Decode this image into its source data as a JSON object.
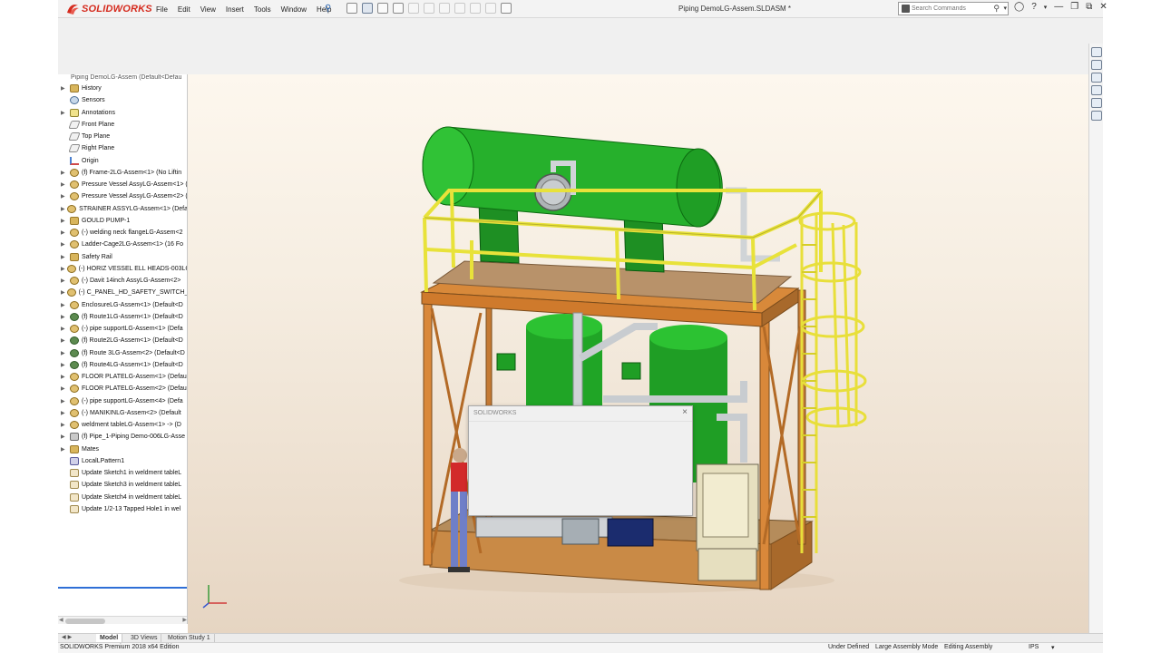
{
  "app": {
    "brand": "SOLIDWORKS",
    "document_title": "Piping DemoLG-Assem.SLDASM *"
  },
  "menu": {
    "items": [
      "File",
      "Edit",
      "View",
      "Insert",
      "Tools",
      "Window",
      "Help"
    ]
  },
  "search": {
    "placeholder": "Search Commands"
  },
  "window_controls": [
    "user-icon",
    "help-icon",
    "minimize-icon",
    "restore-icon",
    "close-icon"
  ],
  "feature_tree": {
    "root": "Piping DemoLG-Assem (Default<Defau",
    "items": [
      {
        "label": "History",
        "icon": "history-folder-icon",
        "expandable": true
      },
      {
        "label": "Sensors",
        "icon": "sensor-icon",
        "expandable": false
      },
      {
        "label": "Annotations",
        "icon": "annotation-icon",
        "expandable": true
      },
      {
        "label": "Front Plane",
        "icon": "plane-icon",
        "expandable": false
      },
      {
        "label": "Top Plane",
        "icon": "plane-icon",
        "expandable": false
      },
      {
        "label": "Right Plane",
        "icon": "plane-icon",
        "expandable": false
      },
      {
        "label": "Origin",
        "icon": "origin-icon",
        "expandable": false
      },
      {
        "label": "(f) Frame-2LG-Assem<1> (No Liftin",
        "icon": "assembly-icon",
        "expandable": true
      },
      {
        "label": "Pressure Vessel AssyLG-Assem<1> (",
        "icon": "assembly-icon",
        "expandable": true
      },
      {
        "label": "Pressure Vessel AssyLG-Assem<2> (",
        "icon": "assembly-icon",
        "expandable": true
      },
      {
        "label": "STRAINER ASSYLG-Assem<1> (Defa",
        "icon": "assembly-icon",
        "expandable": true
      },
      {
        "label": "GOULD PUMP-1",
        "icon": "folder-icon",
        "expandable": true
      },
      {
        "label": "(-) welding neck flangeLG-Assem<2",
        "icon": "assembly-icon",
        "expandable": true
      },
      {
        "label": "Ladder-Cage2LG-Assem<1> (16 Fo",
        "icon": "assembly-icon",
        "expandable": true
      },
      {
        "label": "Safety Rail",
        "icon": "folder-icon",
        "expandable": true
      },
      {
        "label": "(-) HORIZ VESSEL ELL HEADS-003LG",
        "icon": "assembly-icon",
        "expandable": true
      },
      {
        "label": "(-) Davit 14inch AssyLG-Assem<2>",
        "icon": "assembly-icon",
        "expandable": true
      },
      {
        "label": "(-) C_PANEL_HD_SAFETY_SWITCH_",
        "icon": "assembly-icon",
        "expandable": true
      },
      {
        "label": "EnclosureLG-Assem<1> (Default<D",
        "icon": "assembly-icon",
        "expandable": true
      },
      {
        "label": "(f) Route1LG-Assem<1> (Default<D",
        "icon": "route-icon",
        "expandable": true
      },
      {
        "label": "(-) pipe supportLG-Assem<1> (Defa",
        "icon": "assembly-icon",
        "expandable": true
      },
      {
        "label": "(f) Route2LG-Assem<1> (Default<D",
        "icon": "route-icon",
        "expandable": true
      },
      {
        "label": "(f) Route 3LG-Assem<2> (Default<D",
        "icon": "route-icon",
        "expandable": true
      },
      {
        "label": "(f) Route4LG-Assem<1> (Default<D",
        "icon": "route-icon",
        "expandable": true
      },
      {
        "label": "FLOOR PLATELG-Assem<1> (Defau",
        "icon": "assembly-icon",
        "expandable": true
      },
      {
        "label": "FLOOR PLATELG-Assem<2> (Defau",
        "icon": "assembly-icon",
        "expandable": true
      },
      {
        "label": "(-) pipe supportLG-Assem<4> (Defa",
        "icon": "assembly-icon",
        "expandable": true
      },
      {
        "label": "(-) MANIKINLG-Assem<2> (Default",
        "icon": "assembly-icon",
        "expandable": true
      },
      {
        "label": "weldment tableLG-Assem<1> -> (D",
        "icon": "assembly-icon",
        "expandable": true
      },
      {
        "label": "(f) Pipe_1-Piping Demo-006LG-Asse",
        "icon": "part-icon",
        "expandable": true
      },
      {
        "label": "Mates",
        "icon": "mates-folder-icon",
        "expandable": true
      },
      {
        "label": "LocalLPattern1",
        "icon": "pattern-icon",
        "expandable": false
      },
      {
        "label": "Update Sketch1 in weldment tableL",
        "icon": "update-icon",
        "expandable": false
      },
      {
        "label": "Update Sketch3 in weldment tableL",
        "icon": "update-icon",
        "expandable": false
      },
      {
        "label": "Update Sketch4 in weldment tableL",
        "icon": "update-icon",
        "expandable": false
      },
      {
        "label": "Update 1/2-13 Tapped Hole1 in wel",
        "icon": "update-icon",
        "expandable": false
      }
    ]
  },
  "dialog": {
    "title": "SOLIDWORKS",
    "close": "×"
  },
  "tabs": [
    {
      "label": "Model",
      "active": true
    },
    {
      "label": "3D Views",
      "active": false
    },
    {
      "label": "Motion Study 1",
      "active": false
    }
  ],
  "status": {
    "product": "SOLIDWORKS Premium 2018 x64 Edition",
    "definition": "Under Defined",
    "mode": "Large Assembly Mode",
    "editing": "Editing Assembly",
    "units": "IPS"
  },
  "colors": {
    "brand_red": "#d52b1e",
    "vessel_green": "#1f9e25",
    "frame_orange": "#cf7a2c",
    "rail_yellow": "#e8e23a",
    "deck_tan": "#b08a5a"
  }
}
